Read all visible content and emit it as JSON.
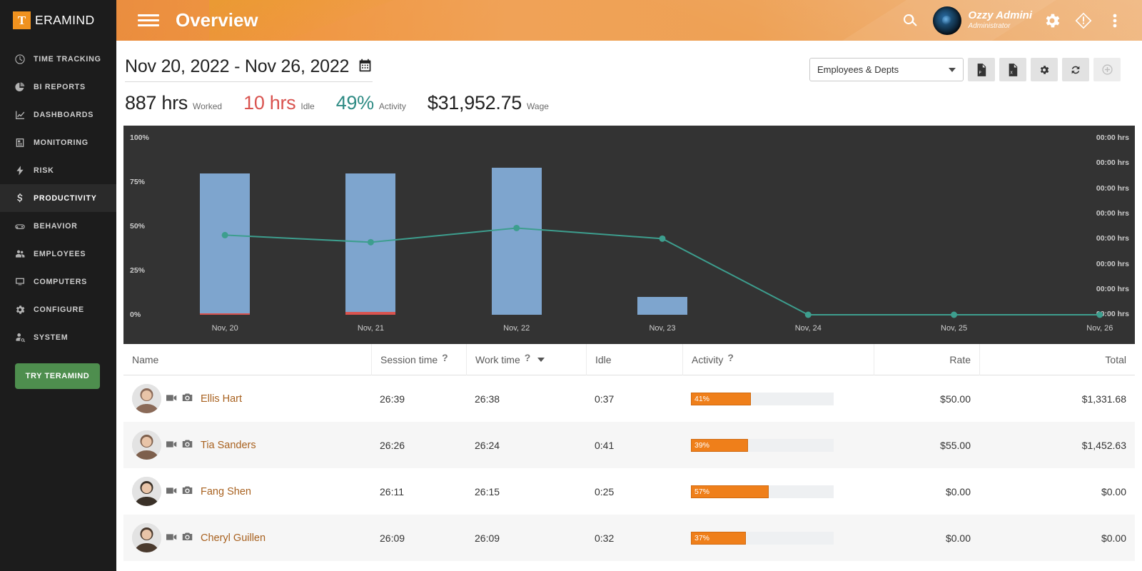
{
  "brand": {
    "mark": "T",
    "name": "ERAMIND"
  },
  "sidebar": {
    "items": [
      {
        "label": "TIME TRACKING",
        "icon": "clock-icon",
        "active": false
      },
      {
        "label": "BI REPORTS",
        "icon": "pie-chart-icon",
        "active": false
      },
      {
        "label": "DASHBOARDS",
        "icon": "chart-line-icon",
        "active": false
      },
      {
        "label": "MONITORING",
        "icon": "monitor-list-icon",
        "active": false
      },
      {
        "label": "RISK",
        "icon": "bolt-icon",
        "active": false
      },
      {
        "label": "PRODUCTIVITY",
        "icon": "dollar-icon",
        "active": true
      },
      {
        "label": "BEHAVIOR",
        "icon": "gamepad-icon",
        "active": false
      },
      {
        "label": "EMPLOYEES",
        "icon": "users-icon",
        "active": false
      },
      {
        "label": "COMPUTERS",
        "icon": "desktop-icon",
        "active": false
      },
      {
        "label": "CONFIGURE",
        "icon": "gear-icon",
        "active": false
      },
      {
        "label": "SYSTEM",
        "icon": "user-search-icon",
        "active": false
      }
    ],
    "cta": "TRY TERAMIND"
  },
  "topbar": {
    "title": "Overview",
    "menu_icon": "hamburger-icon",
    "search_icon": "search-icon",
    "settings_icon": "gear-icon",
    "alert_icon": "warning-diamond-icon",
    "more_icon": "kebab-menu-icon",
    "user": {
      "name": "Ozzy Admini",
      "role": "Administrator"
    }
  },
  "toolbar": {
    "date_range": "Nov 20, 2022 - Nov 26, 2022",
    "calendar_icon": "calendar-icon",
    "scope_select": "Employees & Depts",
    "buttons": [
      {
        "name": "export-pdf-button",
        "icon": "file-pdf-icon"
      },
      {
        "name": "export-excel-button",
        "icon": "file-excel-icon"
      },
      {
        "name": "settings-button",
        "icon": "gear-icon"
      },
      {
        "name": "refresh-button",
        "icon": "refresh-icon"
      },
      {
        "name": "add-widget-button",
        "icon": "plus-circle-icon"
      }
    ]
  },
  "stats": [
    {
      "value": "887 hrs",
      "label": "Worked",
      "color": "#222222"
    },
    {
      "value": "10 hrs",
      "label": "Idle",
      "color": "#d9534f"
    },
    {
      "value": "49%",
      "label": "Activity",
      "color": "#2e8b84"
    },
    {
      "value": "$31,952.75",
      "label": "Wage",
      "color": "#222222"
    }
  ],
  "chart_data": {
    "type": "bar",
    "title": "",
    "xlabel": "",
    "ylabel": "",
    "ylim": [
      0,
      100
    ],
    "ytick_labels": [
      "100%",
      "75%",
      "50%",
      "25%",
      "0%"
    ],
    "ytick_values": [
      100,
      75,
      50,
      25,
      0
    ],
    "right_axis_labels": [
      "00:00 hrs",
      "00:00 hrs",
      "00:00 hrs",
      "00:00 hrs",
      "00:00 hrs",
      "00:00 hrs",
      "00:00 hrs",
      "00:00 hrs"
    ],
    "categories": [
      "Nov, 20",
      "Nov, 21",
      "Nov, 22",
      "Nov, 23",
      "Nov, 24",
      "Nov, 25",
      "Nov, 26"
    ],
    "grid": false,
    "legend": "none",
    "series": [
      {
        "name": "Worked",
        "type": "bar",
        "color": "#7ea5ce",
        "values": [
          80,
          80,
          83,
          10,
          0,
          0,
          0
        ]
      },
      {
        "name": "Idle",
        "type": "bar",
        "color": "#d9534f",
        "values": [
          1,
          3,
          0,
          0,
          0,
          0,
          0
        ]
      },
      {
        "name": "Activity",
        "type": "line",
        "color": "#3d9e8e",
        "values": [
          45,
          41,
          49,
          43,
          0,
          0,
          0
        ]
      }
    ]
  },
  "table": {
    "columns": [
      {
        "key": "name",
        "label": "Name",
        "help": false,
        "align": "left"
      },
      {
        "key": "session",
        "label": "Session time",
        "help": true,
        "align": "left"
      },
      {
        "key": "work",
        "label": "Work time",
        "help": true,
        "sorted": true,
        "align": "left"
      },
      {
        "key": "idle",
        "label": "Idle",
        "help": false,
        "align": "left"
      },
      {
        "key": "activity",
        "label": "Activity",
        "help": true,
        "align": "left"
      },
      {
        "key": "rate",
        "label": "Rate",
        "help": false,
        "align": "right"
      },
      {
        "key": "total",
        "label": "Total",
        "help": false,
        "align": "right"
      }
    ],
    "rows": [
      {
        "name": "Ellis Hart",
        "session": "26:39",
        "work": "26:38",
        "idle": "0:37",
        "activity": "41%",
        "activity_pct": 41,
        "rate": "$50.00",
        "total": "$1,331.68"
      },
      {
        "name": "Tia Sanders",
        "session": "26:26",
        "work": "26:24",
        "idle": "0:41",
        "activity": "39%",
        "activity_pct": 39,
        "rate": "$55.00",
        "total": "$1,452.63"
      },
      {
        "name": "Fang Shen",
        "session": "26:11",
        "work": "26:15",
        "idle": "0:25",
        "activity": "57%",
        "activity_pct": 57,
        "rate": "$0.00",
        "total": "$0.00"
      },
      {
        "name": "Cheryl Guillen",
        "session": "26:09",
        "work": "26:09",
        "idle": "0:32",
        "activity": "37%",
        "activity_pct": 37,
        "rate": "$0.00",
        "total": "$0.00"
      }
    ],
    "row_icons": {
      "video": "video-camera-icon",
      "snapshot": "photo-camera-icon"
    }
  }
}
